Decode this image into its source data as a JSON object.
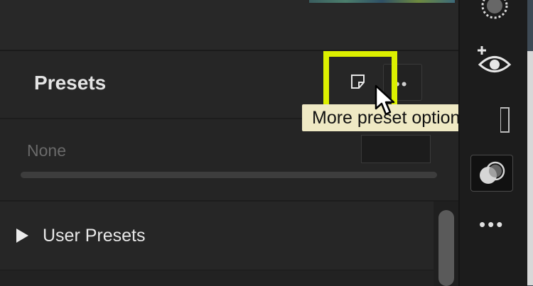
{
  "panel": {
    "presets": {
      "title": "Presets",
      "new_preset_icon": "new-document-icon",
      "more_button_icon": "ellipsis-icon",
      "more_button_label": "••",
      "tooltip": "More preset options"
    },
    "current_preset": {
      "value": "None",
      "amount_value": ""
    },
    "groups": [
      {
        "label": "User Presets",
        "expanded": false
      }
    ]
  },
  "toolbar": {
    "tools": [
      {
        "name": "radial-mask-icon"
      },
      {
        "name": "add-visibility-icon"
      },
      {
        "name": "mask-overlay-icon",
        "active": true
      },
      {
        "name": "more-tools-icon",
        "label": "•••"
      }
    ]
  },
  "colors": {
    "highlight": "#dcf000",
    "tooltip_bg": "#efe9c4",
    "panel_bg": "#262626",
    "toolbar_bg": "#1c1c1c"
  }
}
